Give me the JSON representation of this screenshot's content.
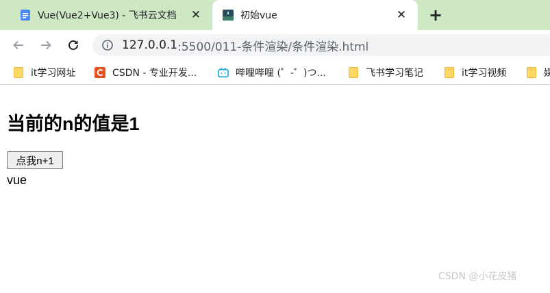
{
  "tabs": [
    {
      "title": "Vue(Vue2+Vue3) - 飞书云文档",
      "active": false
    },
    {
      "title": "初始vue",
      "active": true
    }
  ],
  "address": {
    "host": "127.0.0.1",
    "path": ":5500/011-条件渲染/条件渲染.html"
  },
  "bookmarks": [
    {
      "label": "it学习网址"
    },
    {
      "label": "CSDN - 专业开发..."
    },
    {
      "label": "哔哩哔哩 (゜-゜)つ..."
    },
    {
      "label": "飞书学习笔记"
    },
    {
      "label": "it学习视频"
    },
    {
      "label": "媒"
    }
  ],
  "page": {
    "heading": "当前的n的值是1",
    "button_label": "点我n+1",
    "text": "vue"
  },
  "watermark": "CSDN @小花皮猪",
  "colors": {
    "tabstrip": "#cde8c3",
    "omnibox": "#f1f3f4",
    "csdn": "#e8501f",
    "bilibili": "#23ade5"
  }
}
